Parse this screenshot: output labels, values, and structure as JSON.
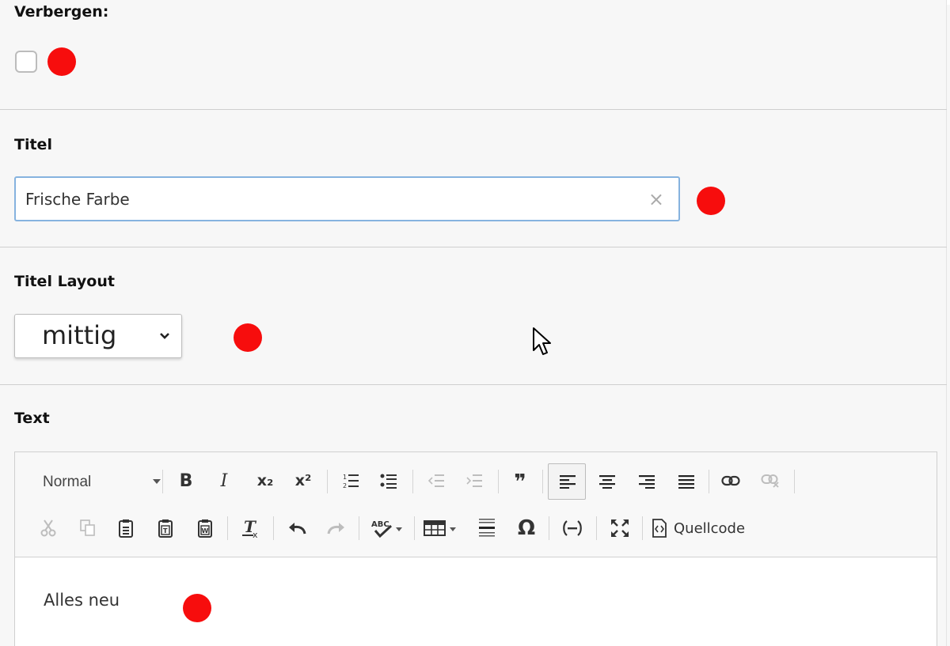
{
  "fields": {
    "hide": {
      "label": "Verbergen:",
      "checked": false
    },
    "title": {
      "label": "Titel",
      "value": "Frische Farbe",
      "clear_symbol": "×"
    },
    "title_layout": {
      "label": "Titel Layout",
      "selected": "mittig"
    },
    "text": {
      "label": "Text",
      "format_select": "Normal",
      "toolbar": {
        "bold": "B",
        "italic": "I",
        "subscript": "x₂",
        "superscript": "x²",
        "blockquote": "❞",
        "omega": "Ω",
        "source_label": "Quellcode"
      },
      "content": "Alles neu"
    }
  },
  "colors": {
    "marker_dot": "#f70d0d",
    "input_focus_border": "#86b3df",
    "background": "#f7f7f7"
  },
  "icons": [
    "bold-icon",
    "italic-icon",
    "subscript-icon",
    "superscript-icon",
    "numbered-list-icon",
    "bullet-list-icon",
    "outdent-icon",
    "indent-icon",
    "blockquote-icon",
    "align-left-icon",
    "align-center-icon",
    "align-right-icon",
    "justify-icon",
    "link-icon",
    "unlink-icon",
    "cut-icon",
    "copy-icon",
    "paste-icon",
    "paste-text-icon",
    "paste-word-icon",
    "remove-format-icon",
    "undo-icon",
    "redo-icon",
    "spellcheck-icon",
    "table-icon",
    "horizontal-line-icon",
    "special-char-icon",
    "non-breaking-space-icon",
    "maximize-icon",
    "source-icon"
  ]
}
